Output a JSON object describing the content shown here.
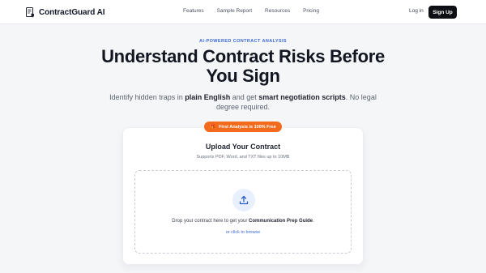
{
  "nav": {
    "brand": "ContractGuard AI",
    "brand_icon": "document-shield-icon",
    "links": [
      "Features",
      "Sample Report",
      "Resources",
      "Pricing"
    ],
    "login": "Log in",
    "signup": "Sign Up"
  },
  "hero": {
    "eyebrow": "AI-POWERED CONTRACT ANALYSIS",
    "headline_line1": "Understand Contract Risks Before",
    "headline_line2": "You Sign",
    "sub_part1": "Identify hidden traps in ",
    "sub_bold1": "plain English",
    "sub_part2": " and get ",
    "sub_bold2": "smart negotiation scripts",
    "sub_part3": ". No legal degree required."
  },
  "upload": {
    "badge": "First Analysis is 100% Free",
    "badge_icon": "gift-icon",
    "title": "Upload Your Contract",
    "supported": "Supports PDF, Word, and TXT files up to 10MB",
    "upload_icon": "upload-icon",
    "drop_part1": "Drop your contract here to get your ",
    "drop_bold": "Communication Prep Guide",
    "drop_part2": ".",
    "browse": "or click to browse"
  },
  "colors": {
    "accent_blue": "#3b6ad6",
    "badge_orange": "#f26b1d",
    "button_dark": "#0d0f14"
  }
}
